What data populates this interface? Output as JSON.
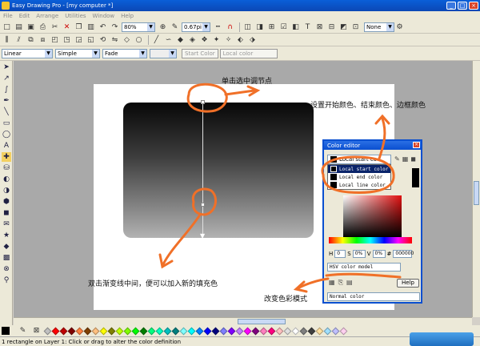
{
  "window": {
    "title": "Easy Drawing Pro - [my computer *]",
    "buttons": [
      "_",
      "□",
      "×"
    ]
  },
  "menu": [
    "File",
    "Edit",
    "Arrange",
    "Utilities",
    "Window",
    "Help"
  ],
  "toolbar1": {
    "zoom": "80%",
    "line_width": "0.67pi",
    "arrow_style": "None"
  },
  "toolbar3": {
    "gradient_type": "Linear",
    "style": "Simple",
    "effect": "Fade",
    "blank_combo": "",
    "start_color_btn": "Start Color",
    "local_color_btn": "Local color"
  },
  "annotations": {
    "click_node": "单击选中调节点",
    "set_colors": "设置开始颜色、结束颜色、边框颜色",
    "double_click": "双击渐变线中间，便可以加入新的填充色",
    "change_mode": "改变色彩模式"
  },
  "color_editor": {
    "title": "Color editor",
    "close": "×",
    "combo_value": "Local start co",
    "options": [
      "Local start color",
      "Local end color",
      "Local line color"
    ],
    "selected_option": 0,
    "h_label": "H",
    "h_value": "0",
    "s_value": "0%",
    "v_label": "V",
    "v_value": "0%",
    "hex_value": "000000",
    "color_model": "HSV color model",
    "help": "Help",
    "mode": "Normal color"
  },
  "palette": {
    "colors": [
      "#c0c0c0",
      "#ff0000",
      "#c00000",
      "#800000",
      "#ff8040",
      "#804000",
      "#ffc080",
      "#ffff00",
      "#808000",
      "#c0ff00",
      "#80ff00",
      "#00ff00",
      "#008000",
      "#00ff80",
      "#00ffc0",
      "#00c0c0",
      "#008080",
      "#80ffff",
      "#00ffff",
      "#0080ff",
      "#0000ff",
      "#000080",
      "#8080ff",
      "#8000ff",
      "#c080ff",
      "#ff00ff",
      "#800080",
      "#ff80c0",
      "#ff0080",
      "#ffc0c0",
      "#e0e0e0",
      "#ffffff",
      "#808080",
      "#404040",
      "#ffe0a0",
      "#a0e0ff",
      "#c0c0ff",
      "#ffd0f0"
    ]
  },
  "status": {
    "text": "1 rectangle on Layer 1: Click or drag to alter the color definition"
  },
  "colors": {
    "annotation_stroke": "#f07028",
    "title_blue": "#0a4fd0"
  }
}
